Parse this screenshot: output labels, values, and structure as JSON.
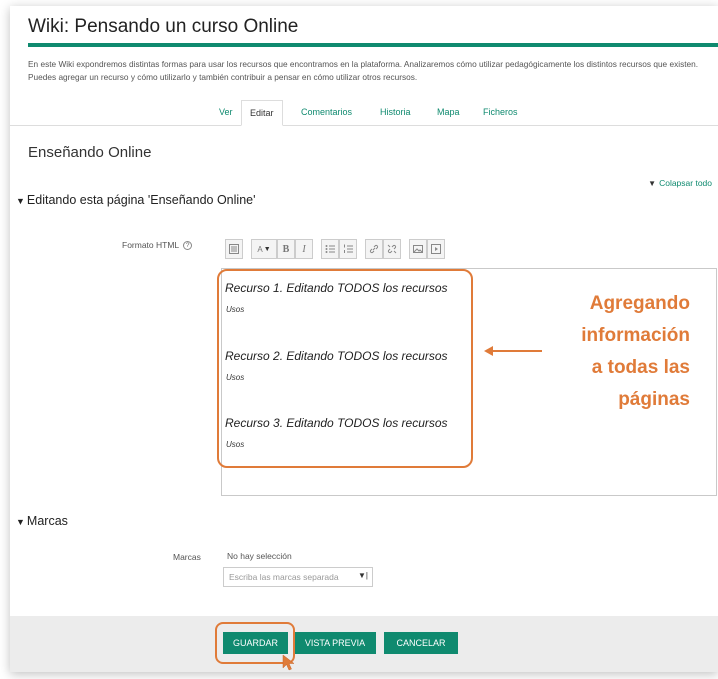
{
  "header": {
    "title": "Wiki: Pensando un curso Online",
    "intro": "En este Wiki expondremos distintas formas para usar los recursos que encontramos en la plataforma. Analizaremos cómo utilizar pedagógicamente los distintos recursos que existen. Puedes agregar un recurso y cómo utilizarlo y también contribuir a pensar en cómo utilizar otros recursos."
  },
  "tabs": [
    {
      "label": "Ver"
    },
    {
      "label": "Editar"
    },
    {
      "label": "Comentarios"
    },
    {
      "label": "Historia"
    },
    {
      "label": "Mapa"
    },
    {
      "label": "Ficheros"
    }
  ],
  "page_name": "Enseñando Online",
  "collapse_all": "Colapsar todo",
  "edit_section": {
    "heading": "Editando esta página 'Enseñando Online'",
    "format_label": "Formato HTML",
    "toolbar": {
      "font_size": "A",
      "bold": "B",
      "italic": "I"
    },
    "content": [
      {
        "title": "Recurso 1. Editando TODOS los recursos",
        "sub": "Usos"
      },
      {
        "title": "Recurso 2. Editando TODOS los recursos",
        "sub": "Usos"
      },
      {
        "title": "Recurso 3. Editando TODOS los recursos",
        "sub": "Usos"
      }
    ]
  },
  "annotation": {
    "lines": [
      "Agregando",
      "información",
      "a todas las",
      "páginas"
    ],
    "color": "#e07b39"
  },
  "tags_section": {
    "heading": "Marcas",
    "label": "Marcas",
    "no_selection": "No hay selección",
    "placeholder": "Escriba las marcas separada"
  },
  "buttons": {
    "save": "GUARDAR",
    "preview": "VISTA PREVIA",
    "cancel": "CANCELAR"
  },
  "colors": {
    "accent": "#0f8a6f",
    "highlight": "#e07b39"
  }
}
